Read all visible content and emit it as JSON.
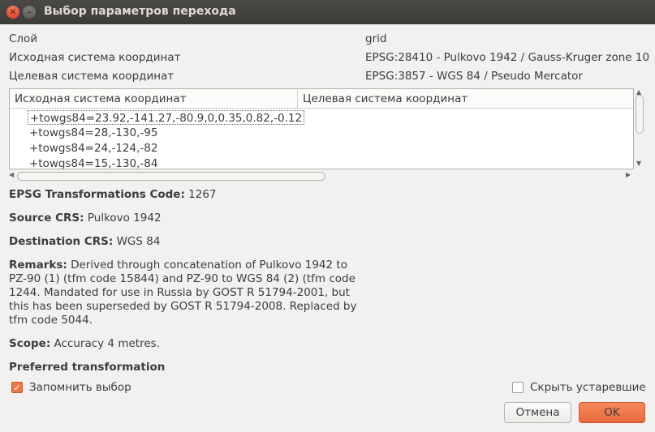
{
  "window": {
    "title": "Выбор параметров перехода"
  },
  "fields": {
    "layer_label": "Слой",
    "layer_value": "grid",
    "source_crs_label": "Исходная система координат",
    "source_crs_value": "EPSG:28410 - Pulkovo 1942 / Gauss-Kruger zone 10",
    "dest_crs_label": "Целевая система координат",
    "dest_crs_value": "EPSG:3857 - WGS 84 / Pseudo Mercator"
  },
  "table": {
    "columns": [
      "Исходная система координат",
      "Целевая система координат"
    ],
    "rows": [
      "+towgs84=23.92,-141.27,-80.9,0,0.35,0.82,-0.12",
      "+towgs84=28,-130,-95",
      "+towgs84=24,-124,-82",
      "+towgs84=15,-130,-84"
    ],
    "selected_index": 0
  },
  "details": {
    "code_label": "EPSG Transformations Code:",
    "code_value": " 1267",
    "source_label": "Source CRS:",
    "source_value": " Pulkovo 1942",
    "dest_label": "Destination CRS:",
    "dest_value": " WGS 84",
    "remarks_label": "Remarks:",
    "remarks_value": " Derived through concatenation of Pulkovo 1942 to PZ-90 (1) (tfm code 15844) and PZ-90 to WGS 84 (2) (tfm code 1244. Mandated for use in Russia by GOST R 51794-2001, but this has been superseded by GOST R 51794-2008. Replaced by tfm code 5044.",
    "scope_label": "Scope:",
    "scope_value": " Accuracy 4 metres.",
    "preferred_label": "Preferred transformation"
  },
  "options": {
    "remember_label": "Запомнить выбор",
    "remember_checked": true,
    "hide_deprecated_label": "Скрыть устаревшие",
    "hide_deprecated_checked": false
  },
  "buttons": {
    "cancel_label": "Отмена",
    "ok_label": "OK"
  },
  "colors": {
    "accent": "#f07746",
    "titlebar": "#3c3b37",
    "close": "#e1462d"
  }
}
